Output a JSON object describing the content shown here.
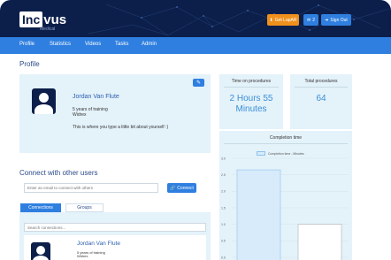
{
  "header": {
    "logo_box": "Inc",
    "logo_rest": "vus",
    "logo_sub": "Medical",
    "login_label": "Get LapAR",
    "messages_count": "2",
    "signout_label": "Sign Out"
  },
  "nav": {
    "items": [
      "Profile",
      "Statistics",
      "Videos",
      "Tasks",
      "Admin"
    ]
  },
  "page": {
    "title": "Profile"
  },
  "profile": {
    "name": "Jordan Van Flute",
    "years": "5 years of training",
    "organization": "Widrex",
    "bio": "This is where you type a little bit about yourself :)"
  },
  "stats": {
    "time_label": "Time on procedures",
    "time_value_line1": "2 Hours 55",
    "time_value_line2": "Minutes",
    "total_label": "Total procedures",
    "total_value": "64"
  },
  "chart_data": {
    "type": "bar",
    "title": "Completion time",
    "series": [
      {
        "name": "Completion time - Minutes",
        "values": [
          2.65,
          1.0
        ]
      }
    ],
    "categories": [
      "",
      ""
    ],
    "ylim": [
      0,
      3.0
    ],
    "ytick_labels": [
      "0.0",
      "0.5",
      "1.0",
      "1.5",
      "2.0",
      "2.5",
      "3.0"
    ],
    "colors": {
      "bar1": "#d7ebfb",
      "bar1_border": "#8fc2ec",
      "bar2": "#ffffff",
      "bar2_border": "#b0b0b0"
    },
    "grid": true,
    "legend": "top"
  },
  "connect": {
    "title": "Connect with other users",
    "email_placeholder": "Enter an email to connect with others",
    "button_label": "Connect",
    "tabs": [
      "Connections",
      "Groups"
    ],
    "search_placeholder": "Search connections...",
    "item": {
      "name": "Jordan Van Flute",
      "years": "5 years of training",
      "organization": "Widrex"
    }
  }
}
